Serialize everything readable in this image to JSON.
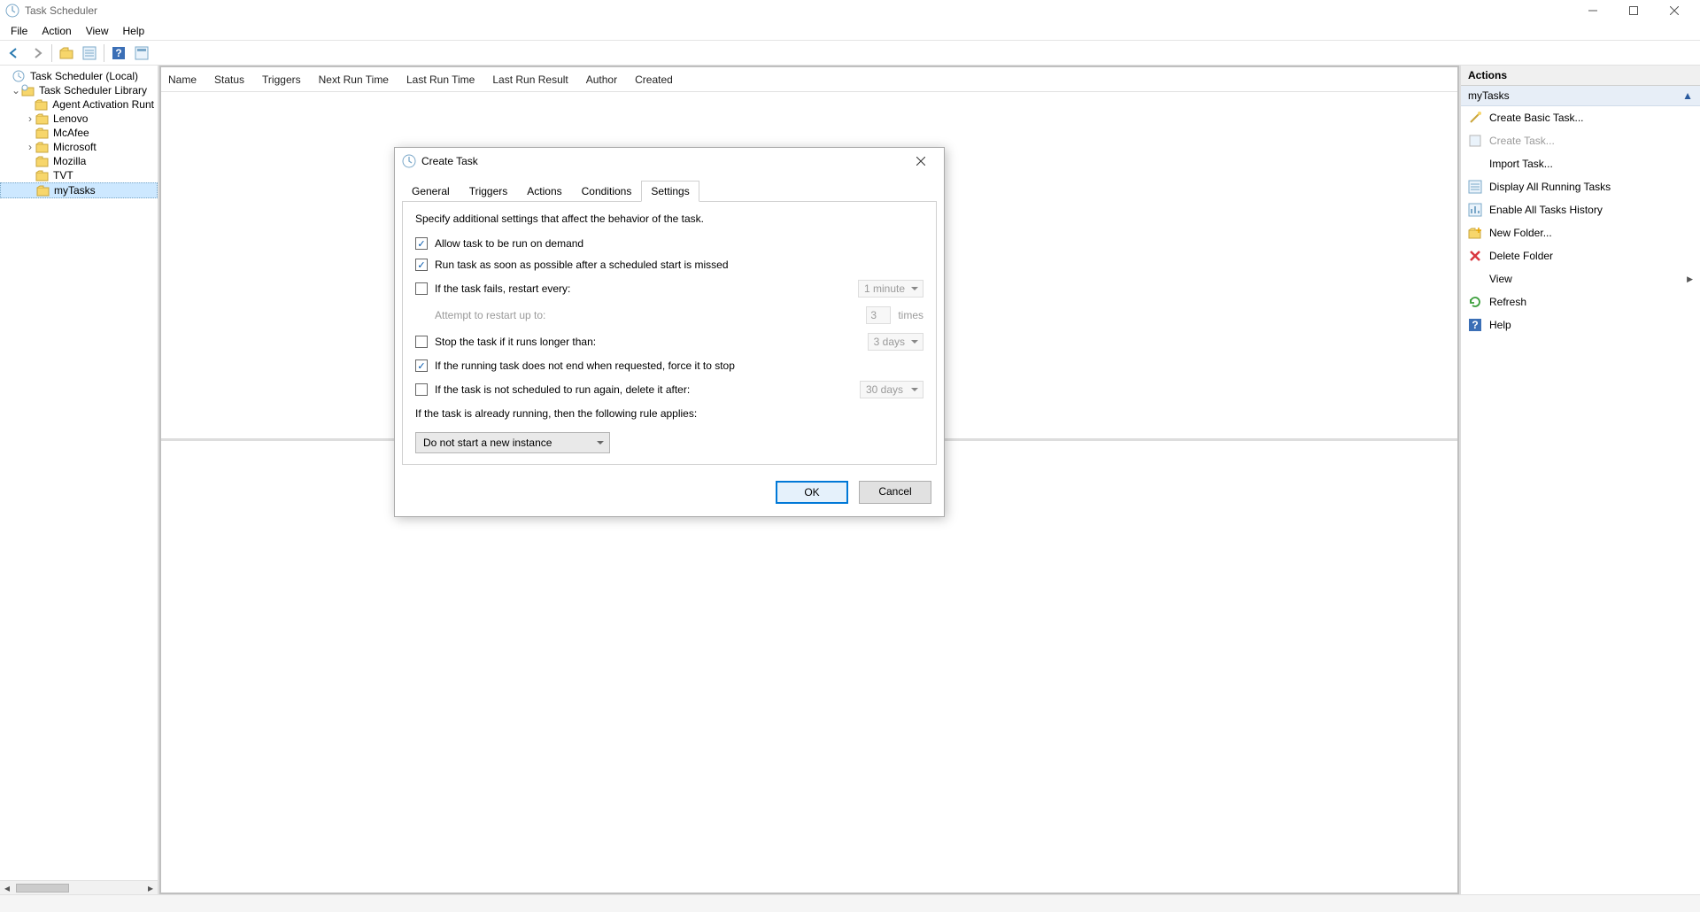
{
  "window": {
    "title": "Task Scheduler",
    "menus": [
      "File",
      "Action",
      "View",
      "Help"
    ]
  },
  "tree": {
    "root": "Task Scheduler (Local)",
    "library": "Task Scheduler Library",
    "nodes": [
      "Agent Activation Runt",
      "Lenovo",
      "McAfee",
      "Microsoft",
      "Mozilla",
      "TVT",
      "myTasks"
    ],
    "selected": "myTasks"
  },
  "columns": [
    "Name",
    "Status",
    "Triggers",
    "Next Run Time",
    "Last Run Time",
    "Last Run Result",
    "Author",
    "Created"
  ],
  "actions": {
    "title": "Actions",
    "group": "myTasks",
    "items": [
      {
        "label": "Create Basic Task...",
        "icon": "wand"
      },
      {
        "label": "Create Task...",
        "icon": "task",
        "disabled": true
      },
      {
        "label": "Import Task...",
        "icon": "blank"
      },
      {
        "label": "Display All Running Tasks",
        "icon": "list"
      },
      {
        "label": "Enable All Tasks History",
        "icon": "history"
      },
      {
        "label": "New Folder...",
        "icon": "newfolder"
      },
      {
        "label": "Delete Folder",
        "icon": "delete"
      },
      {
        "label": "View",
        "icon": "blank",
        "submenu": true
      },
      {
        "label": "Refresh",
        "icon": "refresh"
      },
      {
        "label": "Help",
        "icon": "help"
      }
    ]
  },
  "dialog": {
    "title": "Create Task",
    "tabs": [
      "General",
      "Triggers",
      "Actions",
      "Conditions",
      "Settings"
    ],
    "active_tab": "Settings",
    "desc": "Specify additional settings that affect the behavior of the task.",
    "allow_on_demand": {
      "label": "Allow task to be run on demand",
      "checked": true
    },
    "run_asap": {
      "label": "Run task as soon as possible after a scheduled start is missed",
      "checked": true
    },
    "restart_on_fail": {
      "label": "If the task fails, restart every:",
      "checked": false,
      "interval": "1 minute"
    },
    "restart_attempts": {
      "label": "Attempt to restart up to:",
      "value": "3",
      "suffix": "times"
    },
    "stop_if_longer": {
      "label": "Stop the task if it runs longer than:",
      "checked": false,
      "value": "3 days"
    },
    "force_stop": {
      "label": "If the running task does not end when requested, force it to stop",
      "checked": true
    },
    "delete_after": {
      "label": "If the task is not scheduled to run again, delete it after:",
      "checked": false,
      "value": "30 days"
    },
    "running_rule_label": "If the task is already running, then the following rule applies:",
    "running_rule_value": "Do not start a new instance",
    "ok": "OK",
    "cancel": "Cancel"
  }
}
